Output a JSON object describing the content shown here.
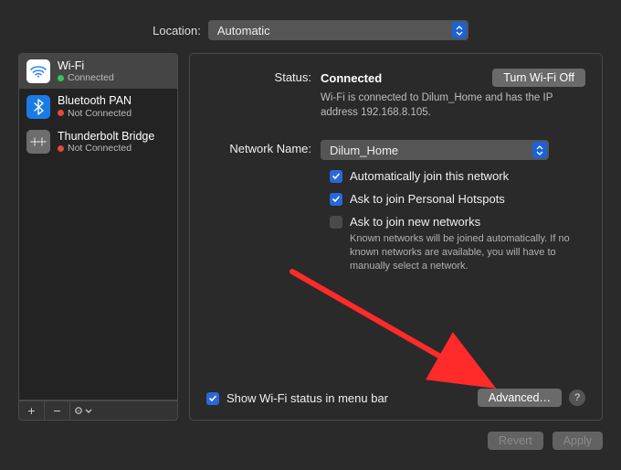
{
  "location": {
    "label": "Location:",
    "selected": "Automatic"
  },
  "interfaces": [
    {
      "icon": "wifi",
      "name": "Wi-Fi",
      "status_dot": "green",
      "status": "Connected",
      "selected": true
    },
    {
      "icon": "bt",
      "name": "Bluetooth PAN",
      "status_dot": "red",
      "status": "Not Connected",
      "selected": false
    },
    {
      "icon": "tb",
      "name": "Thunderbolt Bridge",
      "status_dot": "red",
      "status": "Not Connected",
      "selected": false
    }
  ],
  "sidebar_tools": {
    "add": "+",
    "remove": "−",
    "actions": "⦿⌄"
  },
  "details": {
    "status_label": "Status:",
    "status_value": "Connected",
    "toggle_button": "Turn Wi-Fi Off",
    "status_sub": "Wi-Fi is connected to Dilum_Home and has the IP address 192.168.8.105.",
    "network_label": "Network Name:",
    "network_value": "Dilum_Home",
    "auto_join": {
      "checked": true,
      "label": "Automatically join this network"
    },
    "ask_hotspot": {
      "checked": true,
      "label": "Ask to join Personal Hotspots"
    },
    "ask_new": {
      "checked": false,
      "label": "Ask to join new networks",
      "sub": "Known networks will be joined automatically. If no known networks are available, you will have to manually select a network."
    },
    "show_status": {
      "checked": true,
      "label": "Show Wi-Fi status in menu bar"
    },
    "advanced": "Advanced…",
    "help": "?"
  },
  "footer": {
    "revert": "Revert",
    "apply": "Apply"
  }
}
